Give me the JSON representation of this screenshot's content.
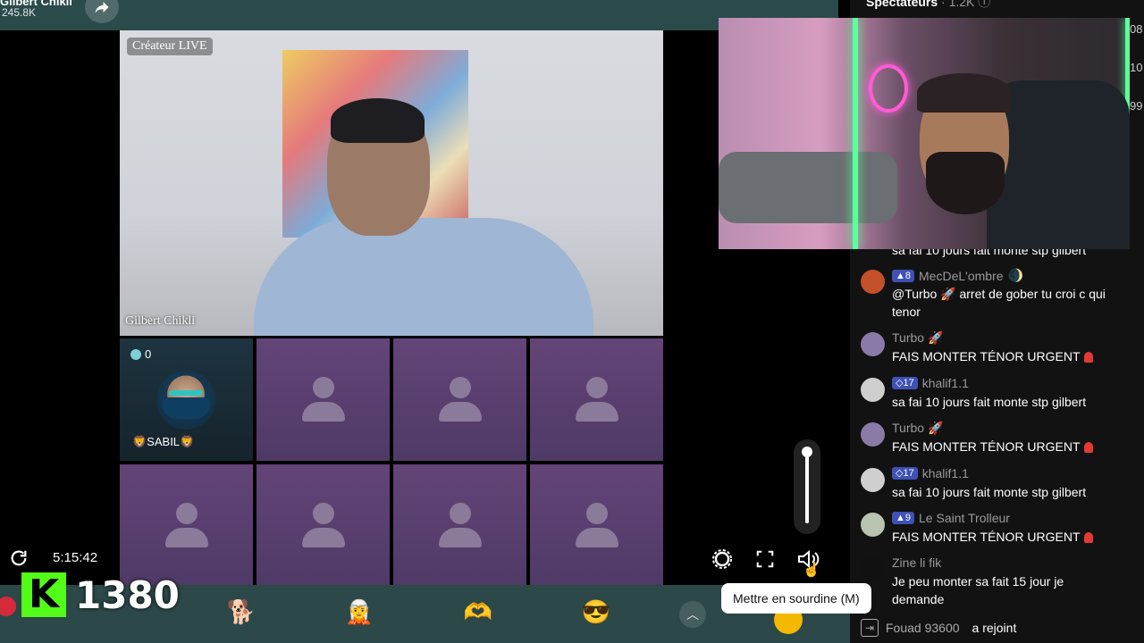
{
  "topbar": {
    "host_name": "Gilbert Chikli",
    "likes": "245.8K",
    "share_icon": "share-arrow-icon"
  },
  "stage": {
    "creator_badge": "Créateur LIVE",
    "host_tag": "Gilbert Chikli",
    "guest": {
      "count": "0",
      "name": "🦁SABIL🦁"
    }
  },
  "side_numbers": [
    "08",
    "10",
    "99"
  ],
  "chat": {
    "header": {
      "title": "Spectateurs",
      "count": "· 1.2K ⓘ"
    },
    "truncated_top": "sa fai 10 jours fait monte stp gilbert",
    "messages": [
      {
        "level": "8",
        "user": "MecDeL'ombre",
        "suffix": "🌒",
        "text": "@Turbo 🚀 arret de gober tu croi c qui tenor",
        "avatar_color": "#c4502a"
      },
      {
        "level": "",
        "user": "Turbo 🚀",
        "suffix": "",
        "text": "FAIS MONTER TÉNOR URGENT",
        "alarm": true,
        "avatar_color": "#8a7aa8"
      },
      {
        "level": "17",
        "user": "khalif1.1",
        "suffix": "",
        "text": "sa fai 10 jours fait monte stp gilbert",
        "avatar_color": "#cfcfcf"
      },
      {
        "level": "",
        "user": "Turbo 🚀",
        "suffix": "",
        "text": "FAIS MONTER TÉNOR URGENT",
        "alarm": true,
        "avatar_color": "#8a7aa8"
      },
      {
        "level": "17",
        "user": "khalif1.1",
        "suffix": "",
        "text": "sa fai 10 jours fait monte stp gilbert",
        "avatar_color": "#cfcfcf"
      },
      {
        "level": "9",
        "user": "Le Saint Trolleur",
        "suffix": "",
        "text": "FAIS MONTER TÉNOR URGENT",
        "alarm": true,
        "avatar_color": "#b8c4b0"
      },
      {
        "level": "",
        "user": "Zine li fik",
        "suffix": "",
        "text": "Je peu monter sa fait 15 jour je demande",
        "avatar_color": "#111111"
      }
    ],
    "join": {
      "name": "Fouad 93600",
      "verb": "a rejoint"
    }
  },
  "controls": {
    "timer": "5:15:42",
    "tooltip": "Mettre en sourdine (M)",
    "volume_level": 1.0
  },
  "kick": {
    "logo": "K",
    "viewers": "1380"
  },
  "gifts": [
    {
      "emoji": "🐕",
      "label": ""
    },
    {
      "emoji": "🧝",
      "label": ""
    },
    {
      "emoji": "🫶",
      "label": ""
    },
    {
      "emoji": "😎",
      "label": ""
    }
  ],
  "colors": {
    "kick_green": "#53fc18",
    "chat_level": "#3f51b5",
    "gift_bar": "#2c4848"
  }
}
